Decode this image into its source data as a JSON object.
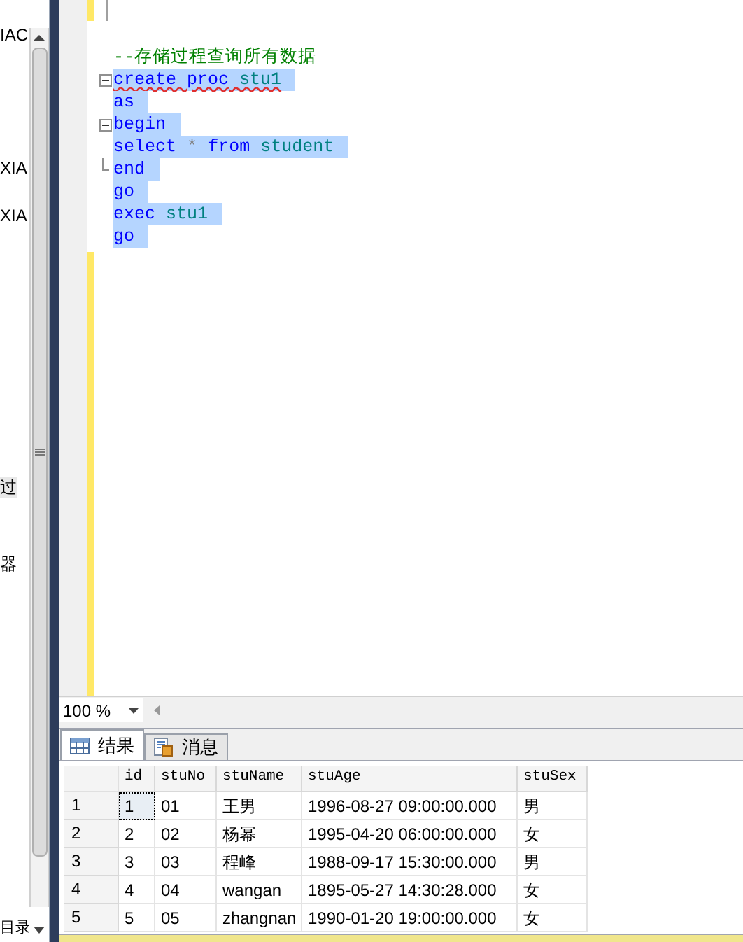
{
  "left_panel": {
    "fragments": [
      {
        "text": "IAC",
        "highlighted": false
      },
      {
        "text": "XIA",
        "highlighted": false
      },
      {
        "text": "XIA",
        "highlighted": false
      },
      {
        "text": "过",
        "highlighted": true
      },
      {
        "text": "器",
        "highlighted": false
      }
    ],
    "footer": "目录"
  },
  "editor": {
    "lines": [
      {
        "selected": false,
        "squiggle": false,
        "tokens": [
          {
            "kind": "comment",
            "text": "--存储过程查询所有数据"
          }
        ]
      },
      {
        "fold_marker": true,
        "fold_end": false,
        "selected": true,
        "squiggle": true,
        "tokens": [
          {
            "kind": "keyword",
            "text": "create proc"
          },
          {
            "kind": "name",
            "text": "stu1"
          }
        ]
      },
      {
        "fold_marker": false,
        "fold_end": false,
        "selected": true,
        "squiggle": false,
        "tokens": [
          {
            "kind": "keyword",
            "text": "as"
          }
        ]
      },
      {
        "fold_marker": true,
        "fold_end": false,
        "selected": true,
        "squiggle": false,
        "tokens": [
          {
            "kind": "keyword",
            "text": "begin"
          }
        ]
      },
      {
        "fold_marker": false,
        "fold_end": false,
        "selected": true,
        "squiggle": false,
        "tokens": [
          {
            "kind": "keyword",
            "text": "select"
          },
          {
            "kind": "operator",
            "text": "*"
          },
          {
            "kind": "keyword",
            "text": "from"
          },
          {
            "kind": "name",
            "text": "student"
          }
        ]
      },
      {
        "fold_marker": false,
        "fold_end": true,
        "selected": true,
        "squiggle": false,
        "tokens": [
          {
            "kind": "keyword",
            "text": "end"
          }
        ]
      },
      {
        "fold_marker": false,
        "fold_end": false,
        "selected": true,
        "squiggle": false,
        "tokens": [
          {
            "kind": "keyword",
            "text": "go"
          }
        ]
      },
      {
        "fold_marker": false,
        "fold_end": false,
        "selected": true,
        "squiggle": false,
        "tokens": [
          {
            "kind": "keyword",
            "text": "exec"
          },
          {
            "kind": "name",
            "text": "stu1"
          }
        ]
      },
      {
        "fold_marker": false,
        "fold_end": false,
        "selected": true,
        "squiggle": false,
        "tokens": [
          {
            "kind": "keyword",
            "text": "go"
          }
        ]
      }
    ]
  },
  "zoom": {
    "value": "100 %"
  },
  "result_tabs": [
    {
      "label": "结果",
      "kind": "grid",
      "selected": true
    },
    {
      "label": "消息",
      "kind": "messages",
      "selected": false
    }
  ],
  "table": {
    "columns": [
      "id",
      "stuNo",
      "stuName",
      "stuAge",
      "stuSex"
    ],
    "rows": [
      {
        "header": "1",
        "cells": [
          "1",
          "01",
          "王男",
          "1996-08-27 09:00:00.000",
          "男"
        ],
        "focused": true
      },
      {
        "header": "2",
        "cells": [
          "2",
          "02",
          "杨幂",
          "1995-04-20 06:00:00.000",
          "女"
        ],
        "focused": false
      },
      {
        "header": "3",
        "cells": [
          "3",
          "03",
          "程峰",
          "1988-09-17 15:30:00.000",
          "男"
        ],
        "focused": false
      },
      {
        "header": "4",
        "cells": [
          "4",
          "04",
          "wangan",
          "1895-05-27 14:30:28.000",
          "女"
        ],
        "focused": false
      },
      {
        "header": "5",
        "cells": [
          "5",
          "05",
          "zhangnan",
          "1990-01-20 19:00:00.000",
          "女"
        ],
        "focused": false
      }
    ]
  }
}
